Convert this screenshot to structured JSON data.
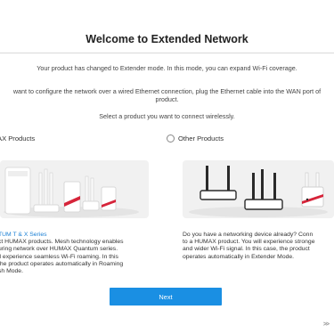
{
  "header": {
    "title": "Welcome to Extended Network"
  },
  "info": {
    "line1": "Your product has changed to Extender mode. In this mode, you can expand Wi-Fi coverage.",
    "line2": "want to configure the network over a wired Ethernet connection, plug the Ethernet cable into the WAN port of",
    "line3": "product.",
    "line4": "Select a product you want to connect wirelessly."
  },
  "options": {
    "humax": {
      "label": "AX Products",
      "selected": true
    },
    "other": {
      "label": "Other Products",
      "selected": false
    }
  },
  "cards": {
    "humax": {
      "series_title": "TUM T & X Series",
      "lines": [
        "ct HUMAX products. Mesh technology enables",
        "uring network over HUMAX Quantum series.",
        "ll experience seamless Wi-Fi roaming. In this",
        "the product operates automatically in Roaming",
        "sh Mode."
      ]
    },
    "other": {
      "lines": [
        "Do you have a networking device already? Conn",
        "to a HUMAX product. You will experience stronge",
        "and wider Wi-Fi signal. In this case, the product",
        "operates automatically in Extender Mode."
      ]
    }
  },
  "footer": {
    "next_label": "Next",
    "more_label": ">>"
  },
  "colors": {
    "accent": "#1a8fe3",
    "link": "#1a7fd4",
    "image_bg": "#f1f1f1"
  }
}
